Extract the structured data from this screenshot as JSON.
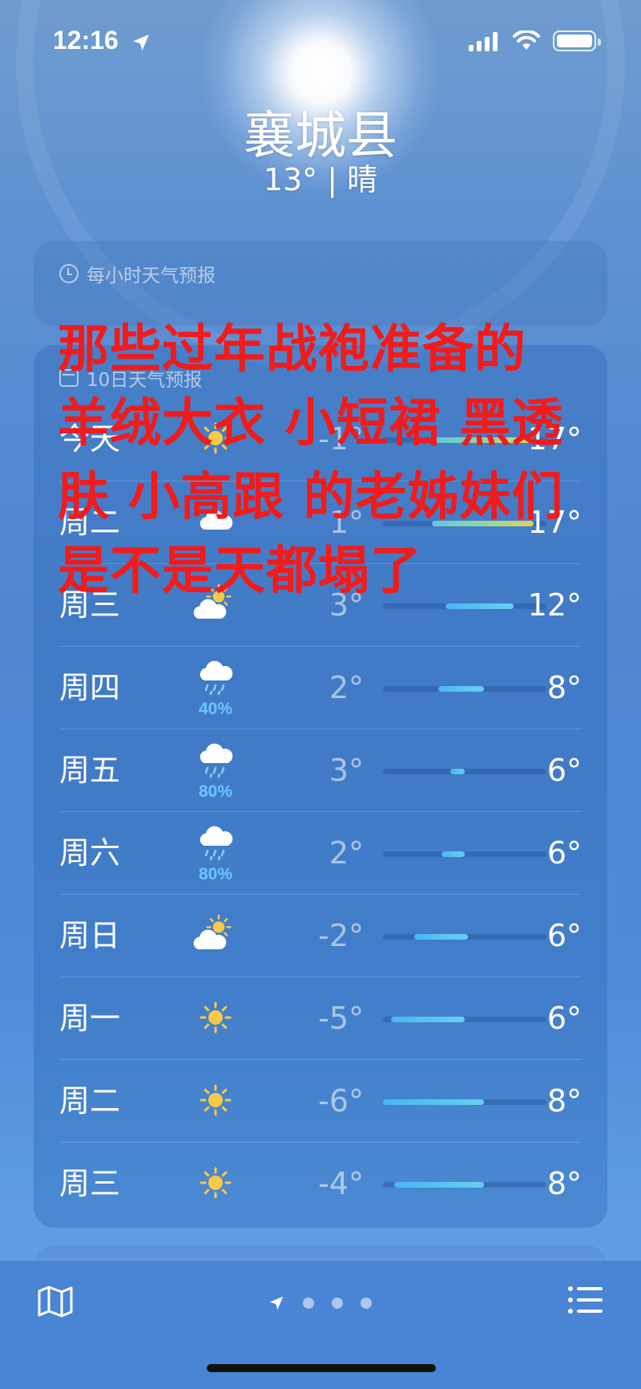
{
  "status_bar": {
    "time": "12:16"
  },
  "location": {
    "city": "襄城县",
    "current": "13° | 晴"
  },
  "hourly": {
    "header": "每小时天气预报"
  },
  "daily": {
    "header": "10日天气预报",
    "rows": [
      {
        "day": "今天",
        "icon": "sun-icon",
        "precip": "",
        "low": "-1°",
        "high": "17°",
        "range": [
          0.32,
          0.92
        ],
        "warm": true
      },
      {
        "day": "周二",
        "icon": "cloud-icon",
        "precip": "",
        "low": "1°",
        "high": "17°",
        "range": [
          0.3,
          0.92
        ],
        "warm": true
      },
      {
        "day": "周三",
        "icon": "partly-cloudy-icon",
        "precip": "",
        "low": "3°",
        "high": "12°",
        "range": [
          0.38,
          0.8
        ],
        "warm": false
      },
      {
        "day": "周四",
        "icon": "rain-icon",
        "precip": "40%",
        "low": "2°",
        "high": "8°",
        "range": [
          0.34,
          0.62
        ],
        "warm": false
      },
      {
        "day": "周五",
        "icon": "rain-icon",
        "precip": "80%",
        "low": "3°",
        "high": "6°",
        "range": [
          0.41,
          0.5
        ],
        "warm": false
      },
      {
        "day": "周六",
        "icon": "rain-icon",
        "precip": "80%",
        "low": "2°",
        "high": "6°",
        "range": [
          0.36,
          0.5
        ],
        "warm": false
      },
      {
        "day": "周日",
        "icon": "partly-cloudy-icon",
        "precip": "",
        "low": "-2°",
        "high": "6°",
        "range": [
          0.19,
          0.52
        ],
        "warm": false
      },
      {
        "day": "周一",
        "icon": "sun-icon",
        "precip": "",
        "low": "-5°",
        "high": "6°",
        "range": [
          0.05,
          0.5
        ],
        "warm": false
      },
      {
        "day": "周二",
        "icon": "sun-icon",
        "precip": "",
        "low": "-6°",
        "high": "8°",
        "range": [
          0.0,
          0.62
        ],
        "warm": false
      },
      {
        "day": "周三",
        "icon": "sun-icon",
        "precip": "",
        "low": "-4°",
        "high": "8°",
        "range": [
          0.07,
          0.62
        ],
        "warm": false
      }
    ]
  },
  "overlay": {
    "lines": [
      "那些过年战袍准备的",
      "羊绒大衣 小短裙 黑透",
      "肤 小高跟 的老姊妹们",
      "是不是天都塌了"
    ],
    "color": "#f21a1a"
  },
  "colors": {
    "precip": "#6cc8ff",
    "sun": "#f7c948",
    "bar": "#4bb6f0"
  }
}
